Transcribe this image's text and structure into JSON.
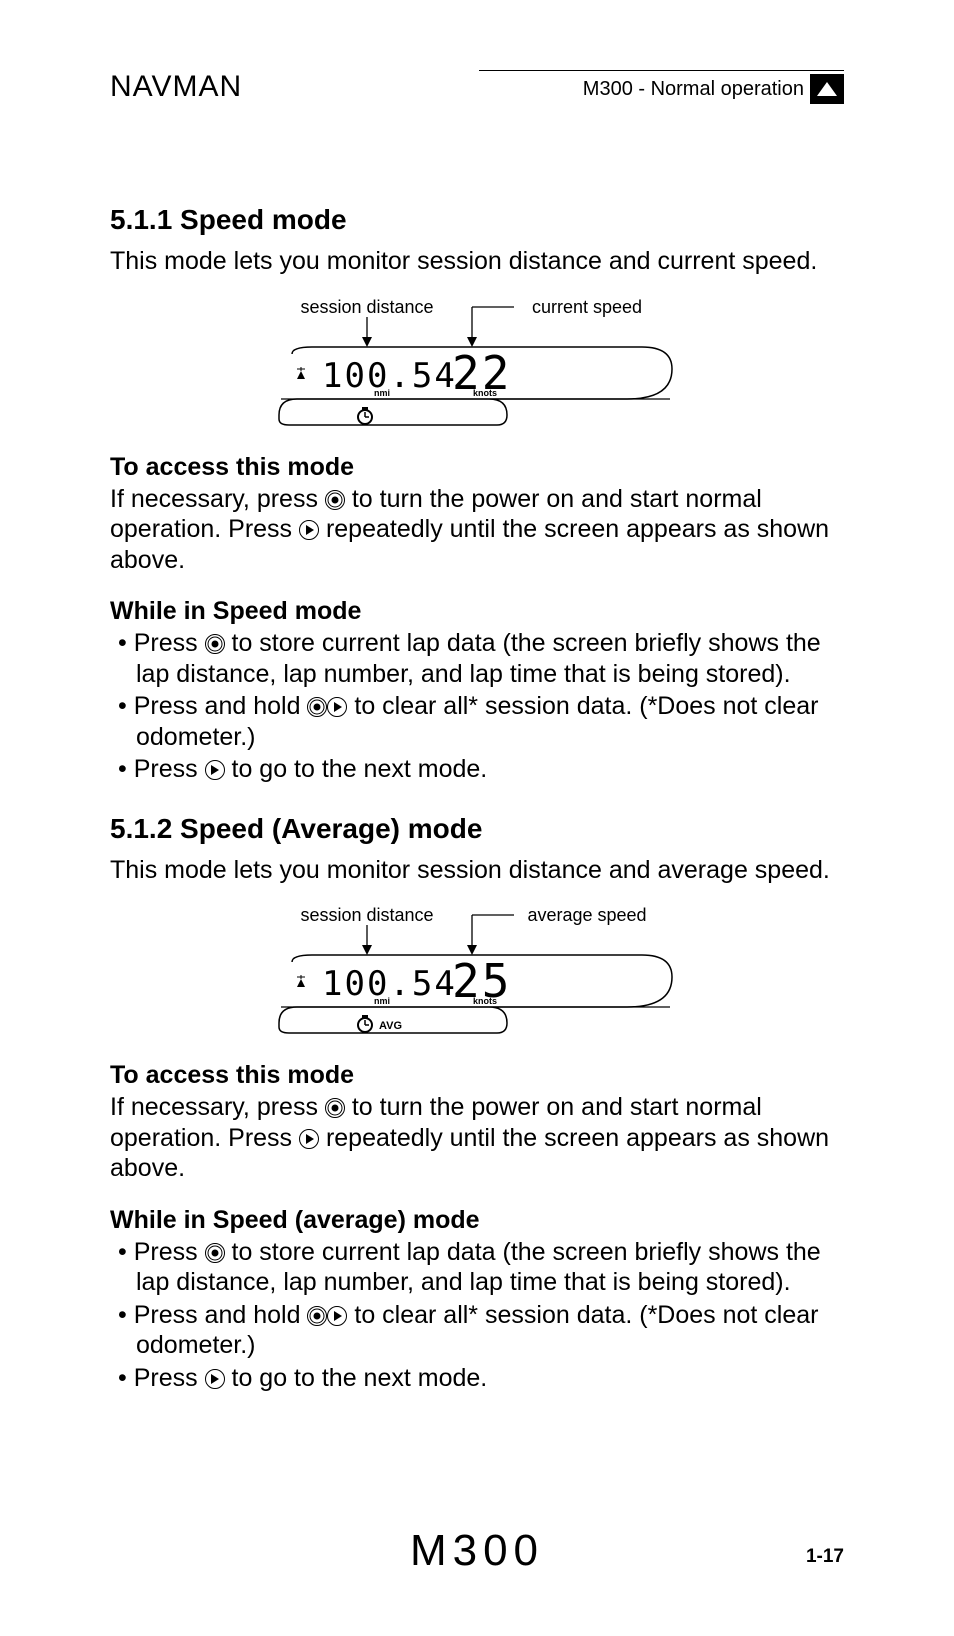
{
  "header": {
    "brand": "NAVMAN",
    "model_section": "M300 - Normal operation"
  },
  "section1": {
    "heading": "5.1.1 Speed mode",
    "intro": "This mode lets you monitor session distance and current speed.",
    "callout_left": "session distance",
    "callout_right": "current speed",
    "display": {
      "distance_value": "100.54",
      "distance_unit": "nmi",
      "speed_value": "22",
      "speed_unit": "knots",
      "avg_label": ""
    },
    "access_heading": "To access this mode",
    "access_text_pre": "If necessary, press ",
    "access_text_mid": " to turn the power on and start normal operation. Press ",
    "access_text_post": " repeatedly until the screen appears as shown above.",
    "while_heading": "While in Speed mode",
    "bullet1_pre": "Press ",
    "bullet1_post": " to store current lap data (the screen briefly shows the lap distance, lap number, and lap time that is being stored).",
    "bullet2_pre": "Press and hold ",
    "bullet2_post": " to clear all* session data. (*Does not clear odometer.)",
    "bullet3_pre": "Press ",
    "bullet3_post": " to go to the next mode."
  },
  "section2": {
    "heading": "5.1.2 Speed (Average) mode",
    "intro": "This mode lets you monitor session distance and average speed.",
    "callout_left": "session distance",
    "callout_right": "average speed",
    "display": {
      "distance_value": "100.54",
      "distance_unit": "nmi",
      "speed_value": "25",
      "speed_unit": "knots",
      "avg_label": "AVG"
    },
    "access_heading": "To access this mode",
    "access_text_pre": "If necessary, press ",
    "access_text_mid": " to turn the power on and start normal operation. Press ",
    "access_text_post": " repeatedly until the screen appears as shown above.",
    "while_heading": "While in Speed (average) mode",
    "bullet1_pre": "Press ",
    "bullet1_post": " to store current lap data (the screen briefly shows the lap distance, lap number, and lap time that is being stored).",
    "bullet2_pre": "Press and hold ",
    "bullet2_post": " to clear all* session data. (*Does not clear odometer.)",
    "bullet3_pre": "Press ",
    "bullet3_post": " to go to the next mode."
  },
  "footer": {
    "model": "M300",
    "page": "1-17"
  }
}
